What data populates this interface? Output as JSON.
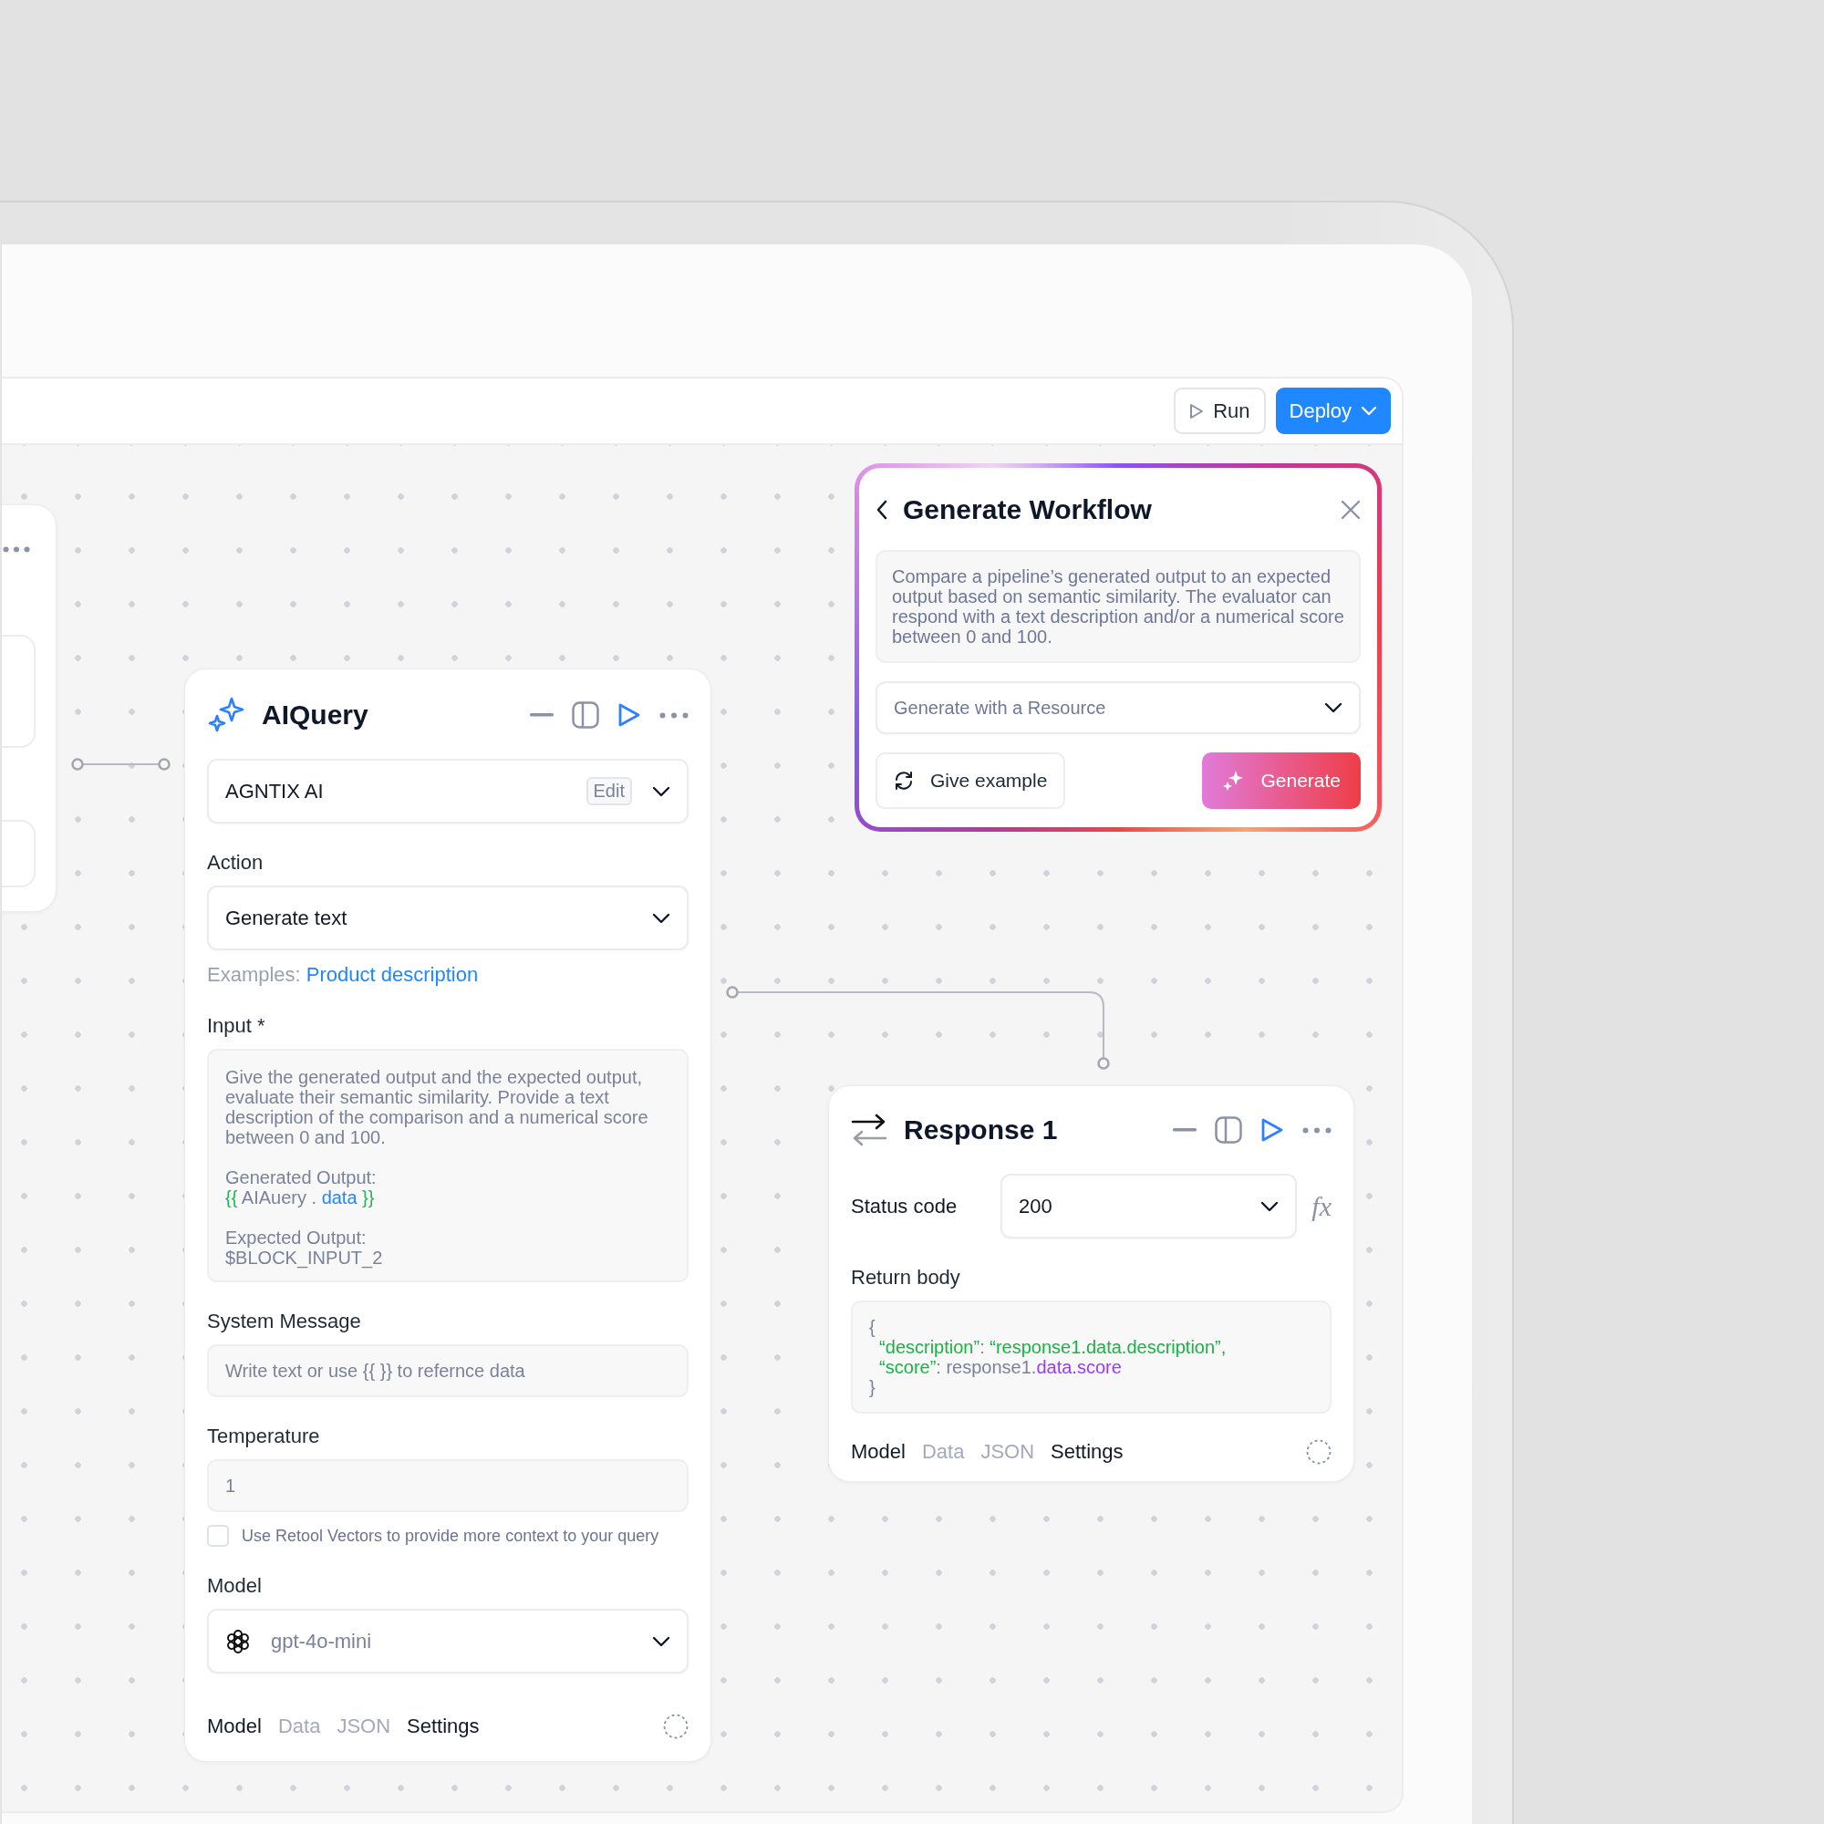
{
  "toolbar": {
    "buttons": [
      {
        "kind": "run",
        "label": "Run"
      },
      {
        "kind": "deploy",
        "label": "Deploy"
      }
    ]
  },
  "ai_query": {
    "title": "AIQuery",
    "resource": {
      "value": "AGNTIX AI",
      "edit": "Edit"
    },
    "action": {
      "label": "Action",
      "value": "Generate text"
    },
    "examples": {
      "label": "Examples:",
      "link": "Product description"
    },
    "input": {
      "label": "Input *",
      "blocks": [
        [
          [
            {
              "kind": "plain",
              "text": "Give the generated output and the expected output, evaluate their semantic similarity. Provide a text description of the comparison and a numerical score between 0 and 100."
            }
          ]
        ],
        [
          [
            {
              "kind": "plain",
              "text": "Generated Output:"
            }
          ],
          [
            {
              "kind": "brace",
              "text": "{{"
            },
            {
              "kind": "plain",
              "text": " AIAuery . "
            },
            {
              "kind": "key",
              "text": "data"
            },
            {
              "kind": "brace",
              "text": " }}"
            }
          ]
        ],
        [
          [
            {
              "kind": "plain",
              "text": "Expected Output:"
            }
          ],
          [
            {
              "kind": "plain",
              "text": "$BLOCK_INPUT_2"
            }
          ]
        ]
      ]
    },
    "system_message": {
      "label": "System Message",
      "placeholder": "Write text or use {{ }} to refernce data"
    },
    "temperature": {
      "label": "Temperature",
      "value": "1"
    },
    "vectors": {
      "label": "Use Retool Vectors to provide more context to your query",
      "checked": false
    },
    "model": {
      "label": "Model",
      "value": "gpt-4o-mini"
    },
    "tabs": [
      {
        "label": "Model",
        "disabled": false
      },
      {
        "label": "Data",
        "disabled": true
      },
      {
        "label": "JSON",
        "disabled": true
      },
      {
        "label": "Settings",
        "disabled": false
      }
    ]
  },
  "generate_workflow": {
    "title": "Generate Workflow",
    "description": "Compare a pipeline’s generated output to an expected output based on semantic similarity. The evaluator can respond with a text description and/or a numerical score between 0 and 100.",
    "resource_select": {
      "placeholder": "Generate with a Resource"
    },
    "buttons": [
      {
        "kind": "secondary",
        "label": "Give example"
      },
      {
        "kind": "primary",
        "label": "Generate"
      }
    ]
  },
  "response": {
    "title": "Response 1",
    "status": {
      "label": "Status code",
      "value": "200",
      "fx": "fx"
    },
    "body": {
      "label": "Return body",
      "lines": [
        [
          {
            "kind": "punct",
            "text": "{"
          }
        ],
        [
          {
            "kind": "string",
            "text": "  “description”"
          },
          {
            "kind": "punct",
            "text": ": "
          },
          {
            "kind": "string",
            "text": "“response1.data.description”,"
          }
        ],
        [
          {
            "kind": "string",
            "text": "  “score”"
          },
          {
            "kind": "punct",
            "text": ": response1."
          },
          {
            "kind": "prop",
            "text": "data.score"
          }
        ],
        [
          {
            "kind": "punct",
            "text": "}"
          }
        ]
      ]
    },
    "tabs": [
      {
        "label": "Model",
        "disabled": false
      },
      {
        "label": "Data",
        "disabled": true
      },
      {
        "label": "JSON",
        "disabled": true
      },
      {
        "label": "Settings",
        "disabled": false
      }
    ]
  }
}
